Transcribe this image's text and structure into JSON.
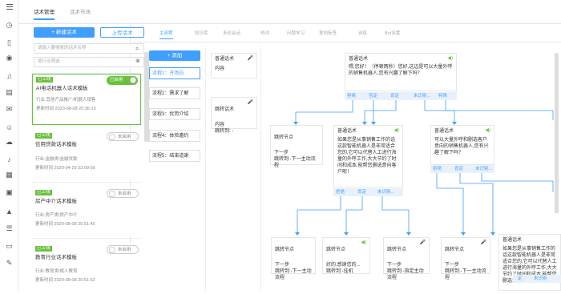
{
  "top_tabs": [
    "话术管理",
    "话术市场"
  ],
  "left": {
    "new_button": "+ 新建话术",
    "upload_button": "上传话术",
    "search_placeholder": "请输入要搜索的话术名称",
    "industry_placeholder": "按行业筛选",
    "cards": [
      {
        "badge": "已上线",
        "title": "AI电话机器人话术模板",
        "toggle": "已启用",
        "industry": "行业:其他产品推广/机器人销售",
        "time": "更新时间 2020-08-08 20:36:13"
      },
      {
        "badge": "已上线",
        "title": "信用贷款话术模板",
        "toggle": "未启用",
        "industry": "行业:金融类/金融贷款",
        "time": "更新时间 2020-04-29 23:09:09"
      },
      {
        "badge": "已上线",
        "title": "房产中介话术模板",
        "toggle": "未启用",
        "industry": "行业:房产类/房产中介",
        "time": "更新时间 2020-08-08 20:51:45"
      },
      {
        "badge": "已上线",
        "title": "教育行业话术模板",
        "toggle": "未启用",
        "industry": "行业:教育类/成人教育",
        "time": "更新时间 2020-08-08 20:51:52"
      }
    ]
  },
  "subtabs": [
    "主流程",
    "知识库",
    "多轮会话",
    "热词",
    "问题学习",
    "意向标签",
    "训练",
    "Bot设置"
  ],
  "add_flow_button": "+ 添加",
  "flows": [
    "流程1：开场白",
    "流程2：需求了解",
    "流程3：优势介绍",
    "流程4：体验邀约",
    "流程5：结束道谢"
  ],
  "side_nodes": [
    {
      "title": "普通话术",
      "body": "内容"
    },
    {
      "title": "跳转话术",
      "body": "内容\n跳转到: -"
    }
  ],
  "nodes": {
    "n1": {
      "title": "普通话术",
      "body": "喂,您好！（停顿两秒）您好,这边是可以大量外呼的销售机器人,您有兴趣了解下吗？"
    },
    "n2": {
      "title": "普通话术",
      "body": "如果您是从事销售工作的话这款智能机器人是非常适合您的,它可以代替人工进行海量的外呼工作,大大节约了时间和成本,能帮您删选意向客户呢！"
    },
    "n3": {
      "title": "普通话术",
      "body": "可以大量外呼和删选客户意向的销售机器人,您有兴趣了解下吗？"
    },
    "j1": {
      "title": "跳转节点",
      "body": "下一步\n跳转到:-下一主动流程"
    },
    "j2": {
      "title": "跳转节点",
      "body": "下一步\n跳转到:-下一主动流程"
    },
    "j3": {
      "title": "跳转节点",
      "body": "好的,感谢您的...\n跳转到:-挂机"
    },
    "j4": {
      "title": "跳转节点",
      "body": "下一步\n跳转到:-指定主动流程"
    },
    "j5": {
      "title": "跳转节点",
      "body": "下一步\n跳转到:-下一主动流程"
    },
    "j6": {
      "title": "跳转节点",
      "body": "下一步\n跳转到:-下一主动流程"
    },
    "n4": {
      "title": "普通话术",
      "body": "如果您是从事销售工作的话这款智能机器人是非常适合您的,它可以代替人工进行海量的外呼工作,大大节约了时间和成本,能帮您删选意向客户呢！"
    }
  },
  "branches": {
    "b1": [
      "拒绝",
      "否定",
      "肯定",
      "未识别...",
      "特殊"
    ],
    "b2": [
      "拒绝",
      "肯定",
      "未识别..."
    ],
    "b3": [
      "拒绝",
      "肯定",
      "未识别..."
    ],
    "b4": [
      "定",
      "未识别"
    ]
  },
  "colors": {
    "primary": "#409eff",
    "success": "#67c23a",
    "mic": "#f56c6c"
  }
}
